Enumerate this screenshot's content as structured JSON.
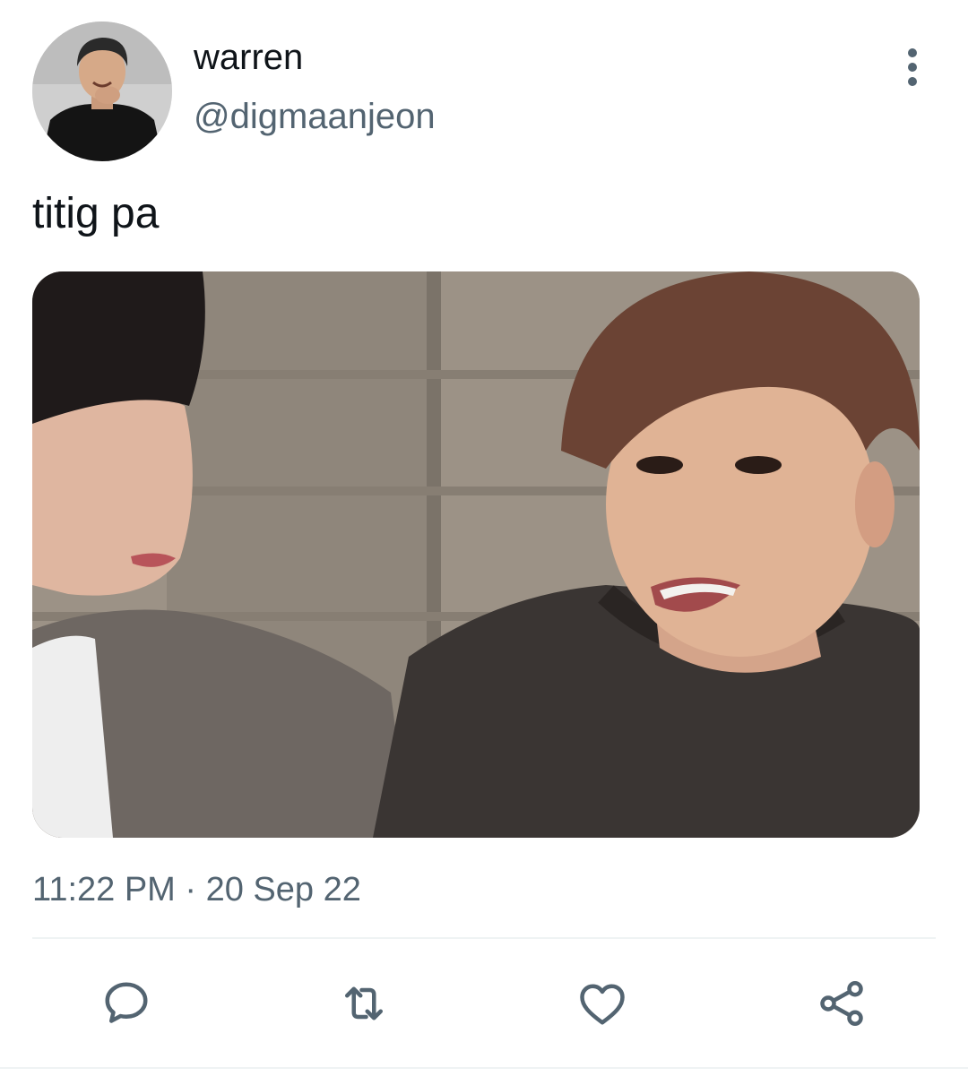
{
  "tweet": {
    "author": {
      "display_name": "warren",
      "handle": "@digmaanjeon",
      "avatar": "profile-photo"
    },
    "text": "titig pa",
    "media": "photo",
    "timestamp": "11:22 PM · 20 Sep 22"
  },
  "actions": {
    "reply_icon": "comment-bubble-icon",
    "retweet_icon": "retweet-arrows-icon",
    "like_icon": "heart-icon",
    "share_icon": "share-nodes-icon"
  },
  "colors": {
    "text_primary": "#0f1419",
    "text_secondary": "#536471",
    "divider": "#eff3f4",
    "background": "#ffffff"
  }
}
